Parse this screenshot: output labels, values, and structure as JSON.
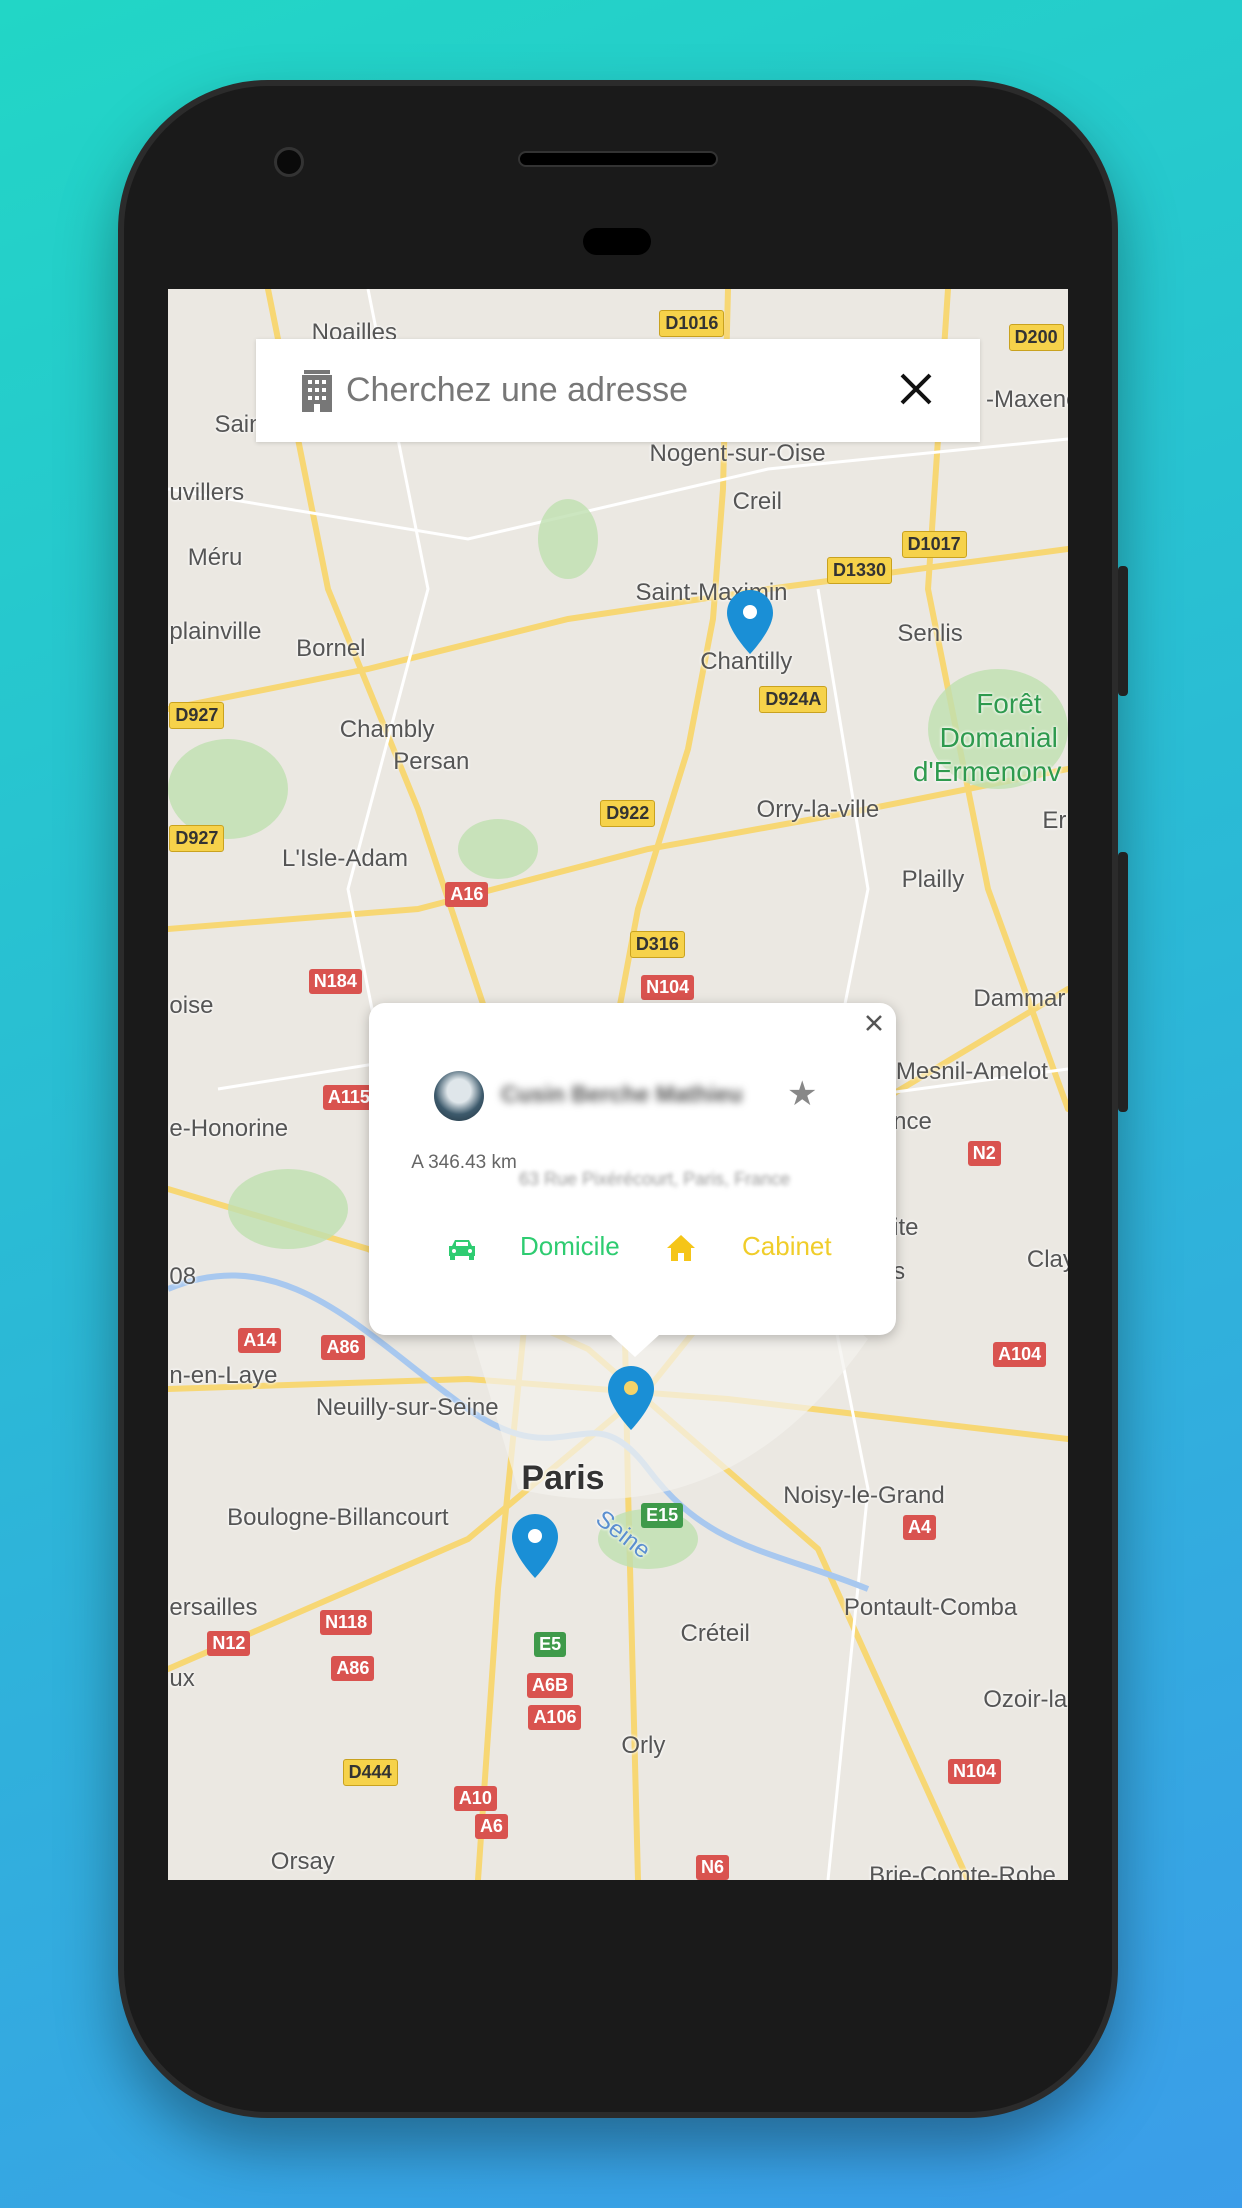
{
  "search": {
    "placeholder": "Cherchez une adresse",
    "icon": "building-icon",
    "clear_icon": "close-icon"
  },
  "map": {
    "places": [
      "Noailles",
      "Sain",
      "uvillers",
      "Méru",
      "Nogent-sur-Oise",
      "Creil",
      "Saint-Maximin",
      "Chantilly",
      "Senlis",
      "Forêt",
      "Domanial",
      "d'Ermenonv",
      "plainville",
      "Bornel",
      "Chambly",
      "Persan",
      "Orry-la-ville",
      "L'Isle-Adam",
      "Plailly",
      "oise",
      "Dammar",
      "Mesnil-Amelot",
      "e-Honorine",
      "Neuilly-sur-Seine",
      "Paris",
      "Noisy-le-Grand",
      "Boulogne-Billancourt",
      "Seine",
      "ersailles",
      "Pontault-Comba",
      "Créteil",
      "ux",
      "Ozoir-la-",
      "Orly",
      "Orsay",
      "Brie-Comte-Robe",
      "Clay",
      "n-en-Laye",
      "-Maxene",
      "Er",
      "nce",
      "s",
      "ite",
      "08"
    ],
    "roads": [
      "D1016",
      "D200",
      "D1017",
      "D1330",
      "D924A",
      "D927",
      "D922",
      "D927",
      "A16",
      "D316",
      "N184",
      "N104",
      "A115",
      "N2",
      "A14",
      "A86",
      "A104",
      "E15",
      "A4",
      "N12",
      "N118",
      "E5",
      "A86",
      "A6B",
      "A106",
      "D444",
      "A10",
      "N104",
      "A6",
      "N6"
    ],
    "pin_color": "#1a8fd6"
  },
  "popup": {
    "name": "Cusin Berche Mathieu",
    "distance": "A 346.43 km",
    "address": "63 Rue Pixérécourt, Paris, France",
    "favorite_icon": "star-icon",
    "actions": [
      {
        "label": "Domicile",
        "icon": "car-icon",
        "color": "#2ecc71"
      },
      {
        "label": "Cabinet",
        "icon": "home-icon",
        "color": "#f5c518"
      }
    ]
  }
}
